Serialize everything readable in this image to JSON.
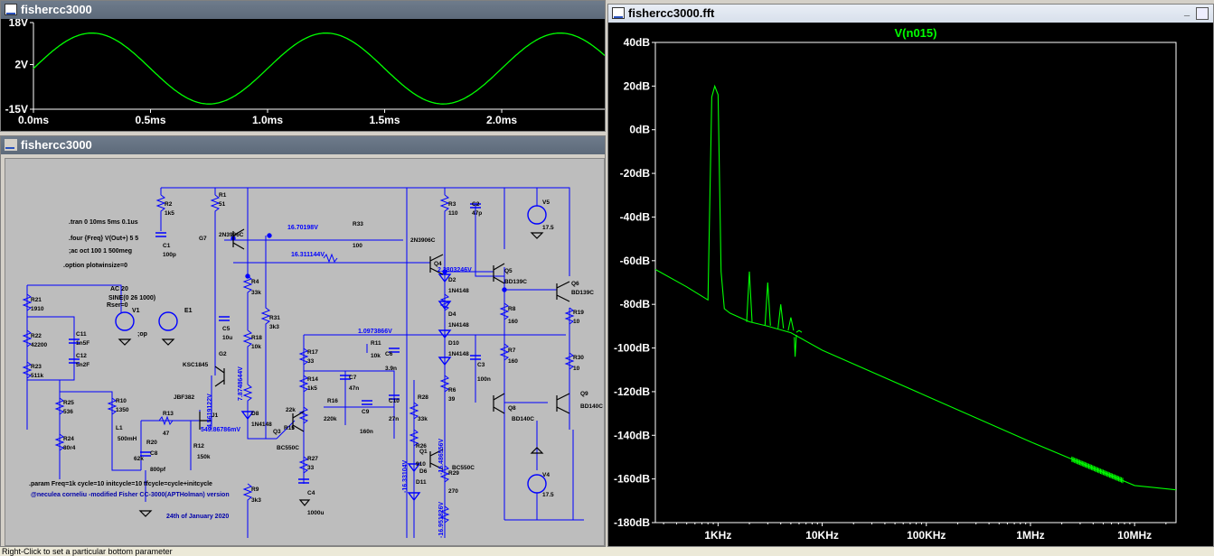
{
  "waveform_window": {
    "title": "fishercc3000",
    "y_ticks": [
      "18V",
      "2V",
      "-15V"
    ],
    "x_ticks": [
      "0.0ms",
      "0.5ms",
      "1.0ms",
      "1.5ms",
      "2.0ms"
    ],
    "trace_color": "#00ff00"
  },
  "schematic_window": {
    "title": "fishercc3000",
    "directives": [
      ".tran 0 10ms 5ms 0.1us",
      ".four {Freq} V(Out+) 5 5",
      ";ac oct 100 1 500meg",
      ".option plotwinsize=0"
    ],
    "param_line": ".param Freq=1k cycle=10 initcycle=10 tfcycle=cycle+initcycle",
    "credit_line": "@neculea corneliu -modified Fisher CC-3000(APTHolman) version",
    "date_line": "24th of January 2020",
    "source": {
      "ac": "AC 20",
      "sine": "SINE(0 26 1000)",
      "rser": "Rser=0",
      "name": "V1",
      "e_name": "E1",
      "op": ";op"
    },
    "node_voltages": [
      "16.70198V",
      "16.311144V",
      "1.0973866V",
      "4.5619122V",
      "7.8748644V",
      "549.86786mV",
      "2.3803246V",
      "-16.33104V",
      "-16.486556V",
      "-16.951826V"
    ],
    "components": [
      {
        "name": "R1",
        "value": "51"
      },
      {
        "name": "R2",
        "value": "1k5"
      },
      {
        "name": "C1",
        "value": "100p"
      },
      {
        "name": "G7",
        "value": "2N3906C"
      },
      {
        "name": "R33",
        "value": "100"
      },
      {
        "name": "R3",
        "value": "110"
      },
      {
        "name": "C2",
        "value": "47p"
      },
      {
        "name": "V5",
        "value": "17.5"
      },
      {
        "name": "R4",
        "value": "33k"
      },
      {
        "name": "R31",
        "value": "3k3"
      },
      {
        "name": "C5",
        "value": "10u"
      },
      {
        "name": "R18",
        "value": "10k"
      },
      {
        "name": "R21",
        "value": "1910"
      },
      {
        "name": "R22",
        "value": "42200"
      },
      {
        "name": "R23",
        "value": "511k"
      },
      {
        "name": "C11",
        "value": "1n5F"
      },
      {
        "name": "C12",
        "value": "5n2F"
      },
      {
        "name": "R25",
        "value": "536"
      },
      {
        "name": "R24",
        "value": "80r4"
      },
      {
        "name": "R10",
        "value": "1350"
      },
      {
        "name": "L1",
        "value": "500mH"
      },
      {
        "name": "R20",
        "value": "62k"
      },
      {
        "name": "C8",
        "value": "800pf"
      },
      {
        "name": "R13",
        "value": "47"
      },
      {
        "name": "R12",
        "value": "150k"
      },
      {
        "name": "J1",
        "value": "JBF382"
      },
      {
        "name": "G2",
        "value": "KSC1845"
      },
      {
        "name": "R17",
        "value": "33"
      },
      {
        "name": "R11",
        "value": "10k"
      },
      {
        "name": "C6",
        "value": "3.9n"
      },
      {
        "name": "R14",
        "value": "1k5"
      },
      {
        "name": "C7",
        "value": "47n"
      },
      {
        "name": "C9",
        "value": "160n"
      },
      {
        "name": "R16",
        "value": "220k"
      },
      {
        "name": "C10",
        "value": "27n"
      },
      {
        "name": "R15",
        "value": "22k"
      },
      {
        "name": "Q3",
        "value": "BC550C"
      },
      {
        "name": "R27",
        "value": "33"
      },
      {
        "name": "C4",
        "value": "1000u"
      },
      {
        "name": "R9",
        "value": "3k3"
      },
      {
        "name": "D8",
        "value": "1N4148"
      },
      {
        "name": "D2",
        "value": "1N4148"
      },
      {
        "name": "D4",
        "value": "1N4148"
      },
      {
        "name": "D10",
        "value": "1N4148"
      },
      {
        "name": "C3",
        "value": "100n"
      },
      {
        "name": "R6",
        "value": "39"
      },
      {
        "name": "R28",
        "value": "33k"
      },
      {
        "name": "R26",
        "value": "910"
      },
      {
        "name": "Q1",
        "value": "BC550C"
      },
      {
        "name": "D6",
        "value": "D11"
      },
      {
        "name": "R29",
        "value": "270"
      },
      {
        "name": "Q5",
        "value": "BD139C"
      },
      {
        "name": "Q6",
        "value": "BD139C"
      },
      {
        "name": "R8",
        "value": "160"
      },
      {
        "name": "R7",
        "value": "160"
      },
      {
        "name": "R19",
        "value": "10"
      },
      {
        "name": "R30",
        "value": "10"
      },
      {
        "name": "Q8",
        "value": "BD140C"
      },
      {
        "name": "Q9",
        "value": "BD140C"
      },
      {
        "name": "V4",
        "value": "17.5"
      },
      {
        "name": "Q4",
        "value": "2N3906C"
      }
    ]
  },
  "fft_window": {
    "title": "fishercc3000.fft",
    "trace_label": "V(n015)",
    "y_ticks": [
      "40dB",
      "20dB",
      "0dB",
      "-20dB",
      "-40dB",
      "-60dB",
      "-80dB",
      "-100dB",
      "-120dB",
      "-140dB",
      "-160dB",
      "-180dB"
    ],
    "x_ticks": [
      "1KHz",
      "10KHz",
      "100KHz",
      "1MHz",
      "10MHz"
    ],
    "trace_color": "#00ff00"
  },
  "status_bar": {
    "text": "Right-Click to set a particular bottom parameter"
  },
  "chart_data": [
    {
      "type": "line",
      "title": "",
      "xlabel": "",
      "ylabel": "",
      "x_unit": "ms",
      "y_unit": "V",
      "xlim": [
        0,
        2.5
      ],
      "ylim": [
        -15,
        18
      ],
      "series": [
        {
          "x": [
            0,
            0.25,
            0.5,
            0.75,
            1.0,
            1.25,
            1.5,
            1.75,
            2.0,
            2.25,
            2.5
          ],
          "values": [
            2,
            14,
            2,
            -13,
            2,
            14,
            2,
            -13,
            2,
            14,
            2
          ]
        }
      ]
    },
    {
      "type": "line",
      "title": "V(n015)",
      "xlabel": "",
      "ylabel": "",
      "x_scale": "log",
      "x_unit": "Hz",
      "y_unit": "dB",
      "xlim": [
        250,
        25000000
      ],
      "ylim": [
        -180,
        40
      ],
      "grid": false,
      "series": [
        {
          "name": "V(n015)",
          "x": [
            250,
            500,
            800,
            870,
            930,
            1000,
            1070,
            1150,
            1300,
            2000,
            3000,
            5000,
            10000,
            100000,
            1000000,
            10000000,
            25000000
          ],
          "values": [
            -64,
            -72,
            -78,
            15,
            20,
            16,
            -65,
            -82,
            -84,
            -88,
            -90,
            -93,
            -101,
            -122,
            -143,
            -163,
            -165
          ]
        }
      ]
    }
  ]
}
